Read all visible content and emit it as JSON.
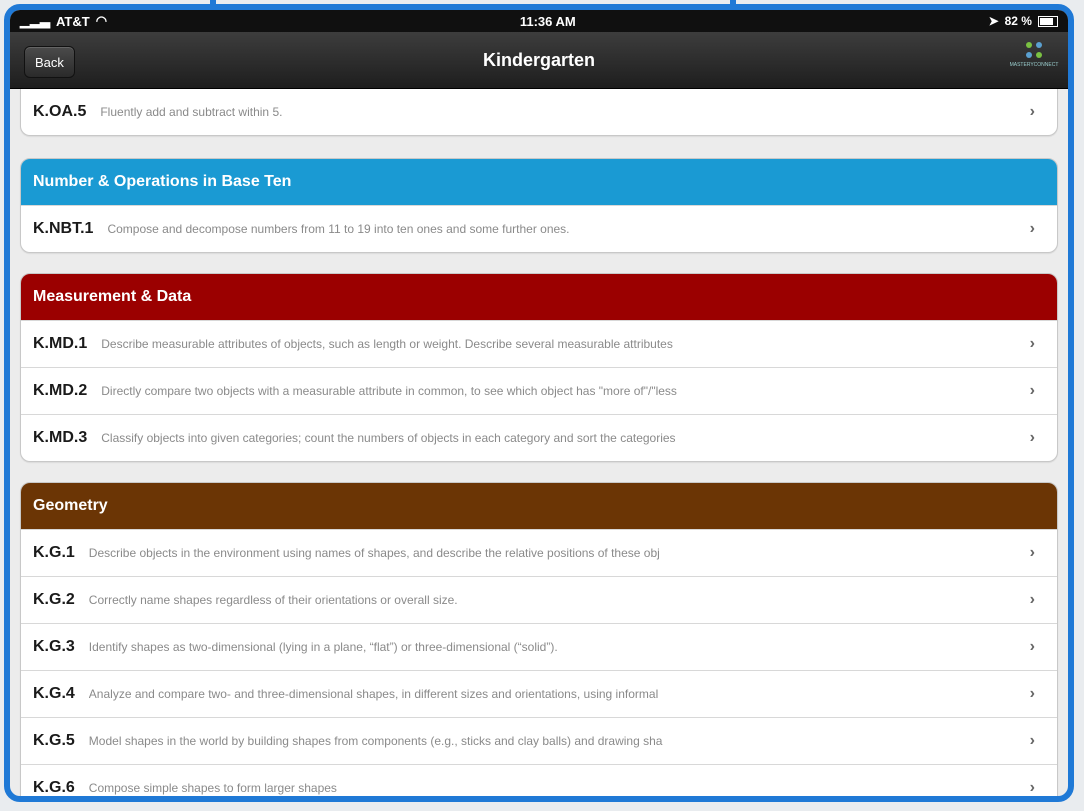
{
  "status": {
    "carrier": "AT&T",
    "time": "11:36 AM",
    "battery": "82 %"
  },
  "nav": {
    "back_label": "Back",
    "title": "Kindergarten",
    "logo_text": "MASTERYCONNECT"
  },
  "colors": {
    "nbt": "#1a9ad3",
    "md": "#9b0000",
    "g": "#6b3505"
  },
  "first_row": {
    "code": "K.OA.5",
    "desc": "Fluently add and subtract within 5."
  },
  "sections": [
    {
      "title": "Number & Operations in Base Ten",
      "rows": [
        {
          "code": "K.NBT.1",
          "desc": "Compose and decompose numbers from 11 to 19 into ten ones and some further ones."
        }
      ]
    },
    {
      "title": "Measurement & Data",
      "rows": [
        {
          "code": "K.MD.1",
          "desc": "Describe measurable attributes of objects, such as length or weight. Describe several measurable attributes"
        },
        {
          "code": "K.MD.2",
          "desc": "Directly compare two objects with a measurable attribute in common, to see which object has \"more of\"/\"less"
        },
        {
          "code": "K.MD.3",
          "desc": "Classify objects into given categories; count the numbers of objects in each category and sort the categories"
        }
      ]
    },
    {
      "title": "Geometry",
      "rows": [
        {
          "code": "K.G.1",
          "desc": "Describe objects in the environment using names of shapes, and describe the relative positions of these obj"
        },
        {
          "code": "K.G.2",
          "desc": "Correctly name shapes regardless of their orientations or overall size."
        },
        {
          "code": "K.G.3",
          "desc": "Identify shapes as two-dimensional (lying in a plane, “flat”) or three-dimensional (“solid”)."
        },
        {
          "code": "K.G.4",
          "desc": "Analyze and compare two- and three-dimensional shapes, in different sizes and orientations, using informal"
        },
        {
          "code": "K.G.5",
          "desc": "Model shapes in the world by building shapes from components (e.g., sticks and clay balls) and drawing sha"
        },
        {
          "code": "K.G.6",
          "desc": "Compose simple shapes to form larger shapes"
        }
      ]
    }
  ]
}
